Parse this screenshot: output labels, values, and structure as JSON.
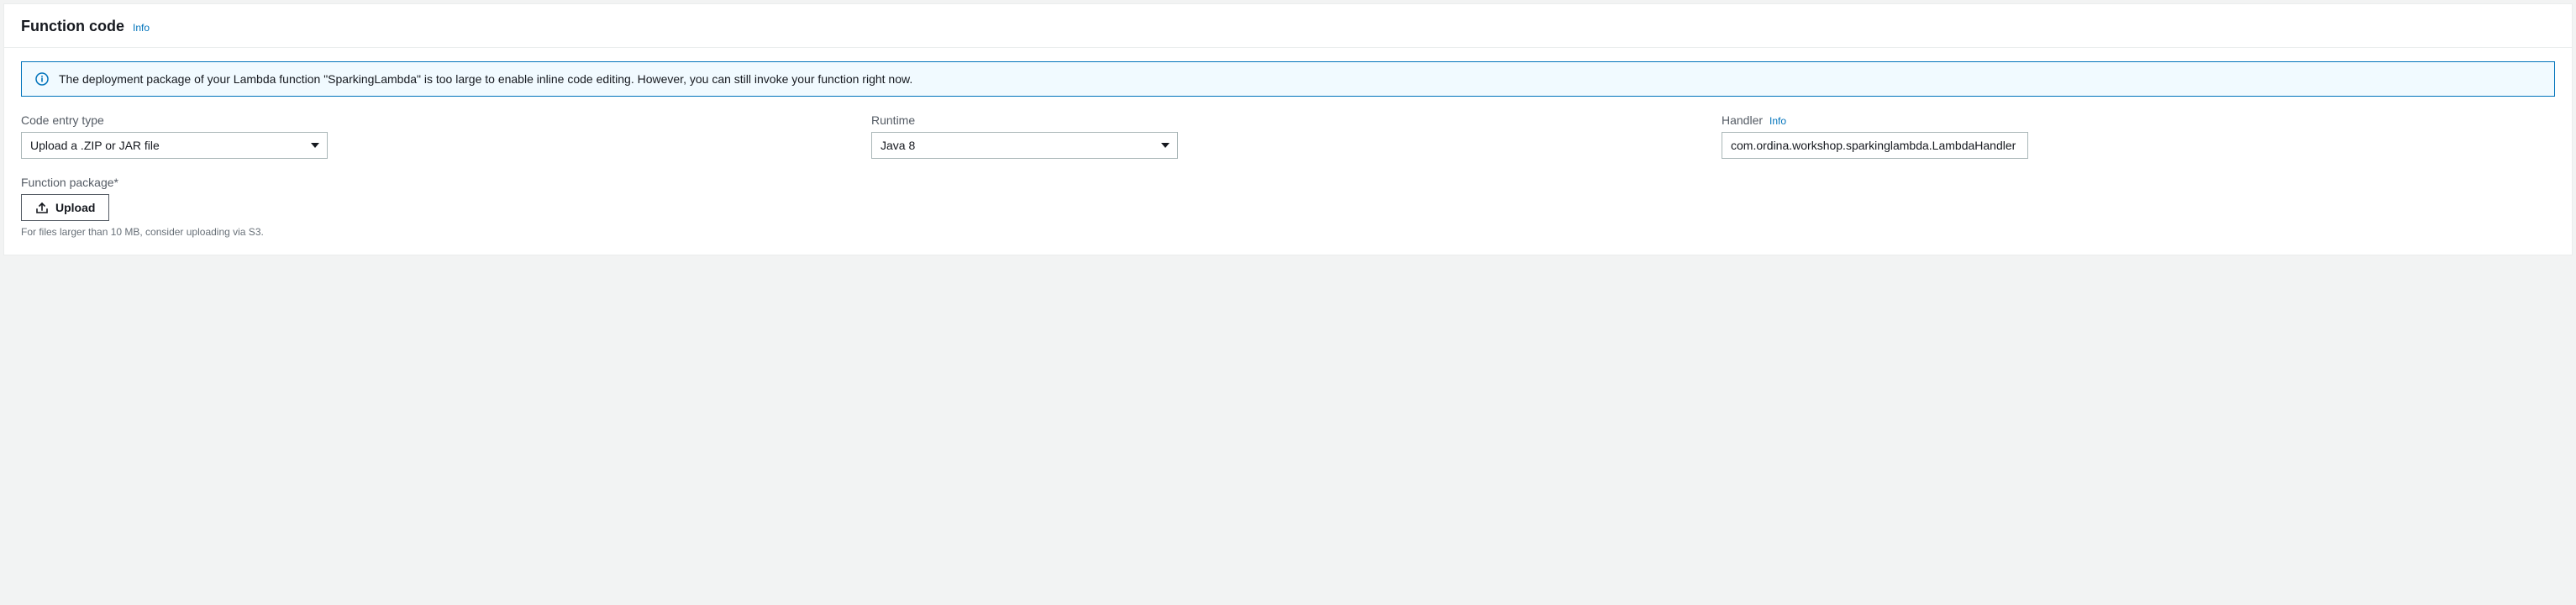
{
  "panel": {
    "title": "Function code",
    "info_label": "Info"
  },
  "alert": {
    "message": "The deployment package of your Lambda function \"SparkingLambda\" is too large to enable inline code editing. However, you can still invoke your function right now."
  },
  "form": {
    "code_entry": {
      "label": "Code entry type",
      "value": "Upload a .ZIP or JAR file"
    },
    "runtime": {
      "label": "Runtime",
      "value": "Java 8"
    },
    "handler": {
      "label": "Handler",
      "info_label": "Info",
      "value": "com.ordina.workshop.sparkinglambda.LambdaHandler"
    },
    "function_package": {
      "label": "Function package*",
      "upload_label": "Upload",
      "hint": "For files larger than 10 MB, consider uploading via S3."
    }
  }
}
